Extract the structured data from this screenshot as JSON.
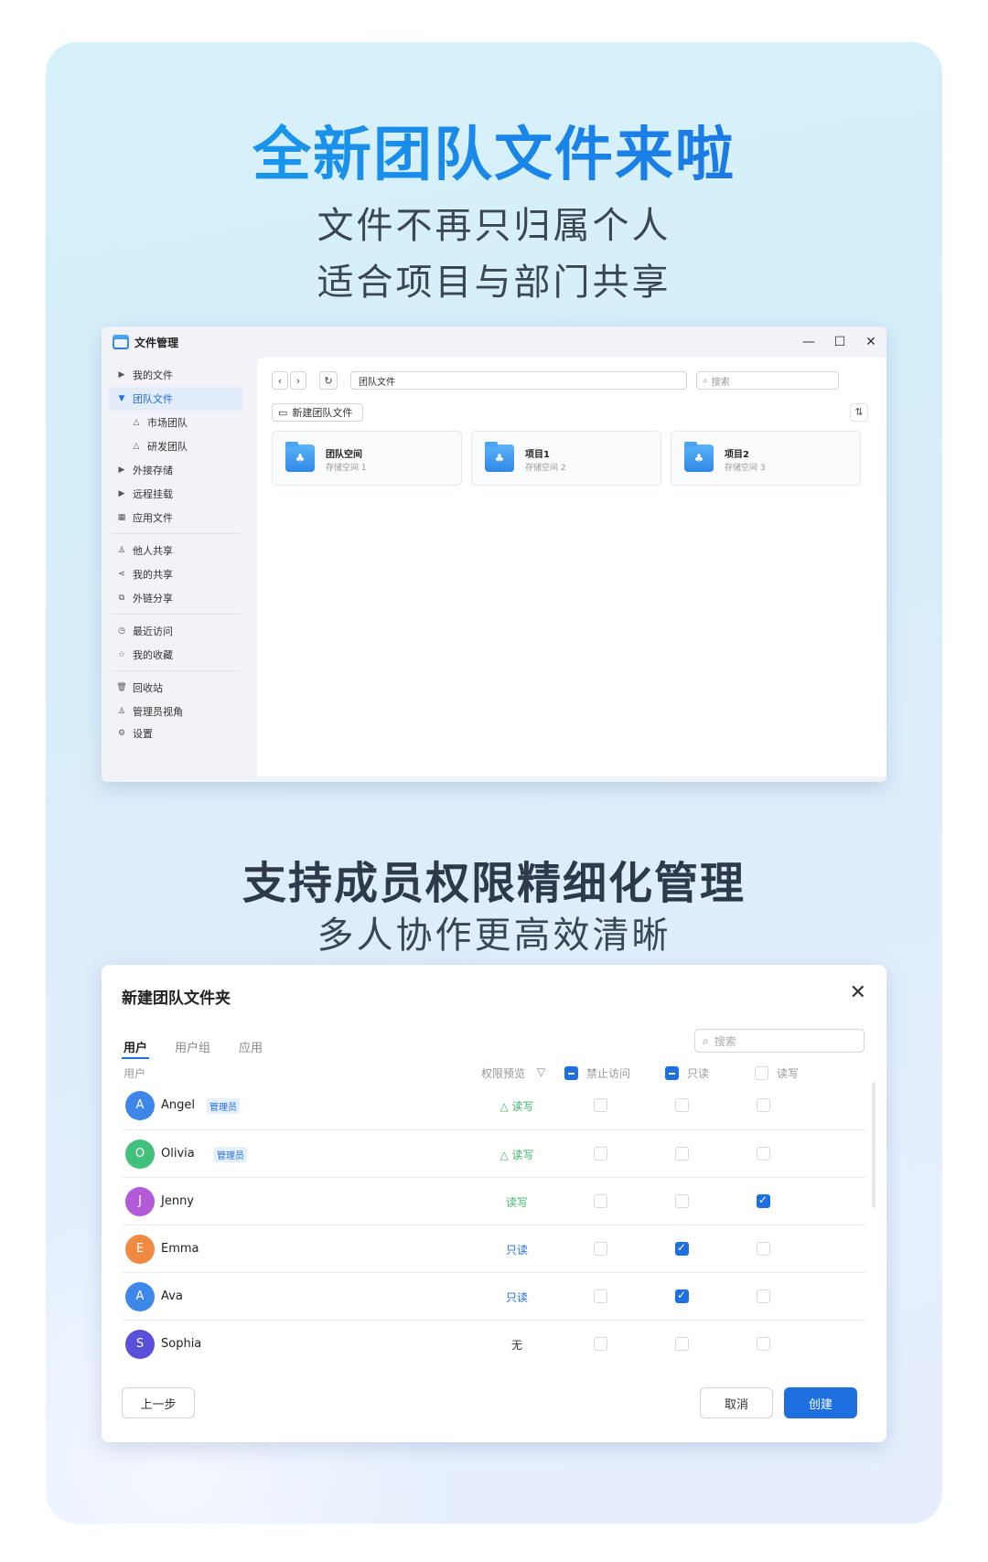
{
  "hero": {
    "title": "全新团队文件来啦",
    "line1": "文件不再只归属个人",
    "line2": "适合项目与部门共享"
  },
  "window": {
    "title": "文件管理",
    "controls": {
      "minimize": "—",
      "maximize": "☐",
      "close": "✕"
    },
    "sidebar": [
      {
        "label": "我的文件",
        "icon": "caret-right-icon"
      },
      {
        "label": "团队文件",
        "icon": "caret-down-icon",
        "active": true
      },
      {
        "label": "市场团队",
        "icon": "team-icon"
      },
      {
        "label": "研发团队",
        "icon": "team-icon"
      },
      {
        "label": "外接存储",
        "icon": "caret-right-icon"
      },
      {
        "label": "远程挂载",
        "icon": "caret-right-icon"
      },
      {
        "label": "应用文件",
        "icon": "apps-icon"
      },
      {
        "label": "他人共享",
        "icon": "user-icon"
      },
      {
        "label": "我的共享",
        "icon": "share-icon"
      },
      {
        "label": "外链分享",
        "icon": "external-link-icon"
      },
      {
        "label": "最近访问",
        "icon": "clock-icon"
      },
      {
        "label": "我的收藏",
        "icon": "star-icon"
      },
      {
        "label": "回收站",
        "icon": "trash-icon"
      },
      {
        "label": "管理员视角",
        "icon": "admin-icon"
      },
      {
        "label": "设置",
        "icon": "gear-icon"
      }
    ],
    "path": "团队文件",
    "search_placeholder": "搜索",
    "new_button": "新建团队文件",
    "tiles": [
      {
        "name": "团队空间",
        "sub": "存储空间 1"
      },
      {
        "name": "项目1",
        "sub": "存储空间 2"
      },
      {
        "name": "项目2",
        "sub": "存储空间 3"
      }
    ]
  },
  "section2": {
    "title": "支持成员权限精细化管理",
    "subtitle": "多人协作更高效清晰"
  },
  "dialog": {
    "title": "新建团队文件夹",
    "tabs": [
      "用户",
      "用户组",
      "应用"
    ],
    "search_placeholder": "搜索",
    "headers": {
      "user": "用户",
      "preview": "权限预览",
      "deny": "禁止访问",
      "read": "只读",
      "rw": "读写"
    },
    "rows": [
      {
        "initial": "A",
        "name": "Angel",
        "badge": "管理员",
        "perm": "△ 读写",
        "perm_color": "#3db86a",
        "color": "#3d87e8",
        "deny": false,
        "read": false,
        "rw": false
      },
      {
        "initial": "O",
        "name": "Olivia",
        "badge": "管理员",
        "perm": "△ 读写",
        "perm_color": "#3db86a",
        "color": "#43c07b",
        "deny": false,
        "read": false,
        "rw": false
      },
      {
        "initial": "J",
        "name": "Jenny",
        "badge": "",
        "perm": "读写",
        "perm_color": "#3db86a",
        "color": "#b35ad9",
        "deny": false,
        "read": false,
        "rw": true
      },
      {
        "initial": "E",
        "name": "Emma",
        "badge": "",
        "perm": "只读",
        "perm_color": "#1e6fe0",
        "color": "#f08a43",
        "deny": false,
        "read": true,
        "rw": false
      },
      {
        "initial": "A",
        "name": "Ava",
        "badge": "",
        "perm": "只读",
        "perm_color": "#1e6fe0",
        "color": "#3d87e8",
        "deny": false,
        "read": true,
        "rw": false
      },
      {
        "initial": "S",
        "name": "Sophia",
        "badge": "",
        "perm": "无",
        "perm_color": "#333333",
        "color": "#5a4fd8",
        "deny": false,
        "read": false,
        "rw": false
      }
    ],
    "prev_button": "上一步",
    "cancel_button": "取消",
    "create_button": "创建"
  }
}
